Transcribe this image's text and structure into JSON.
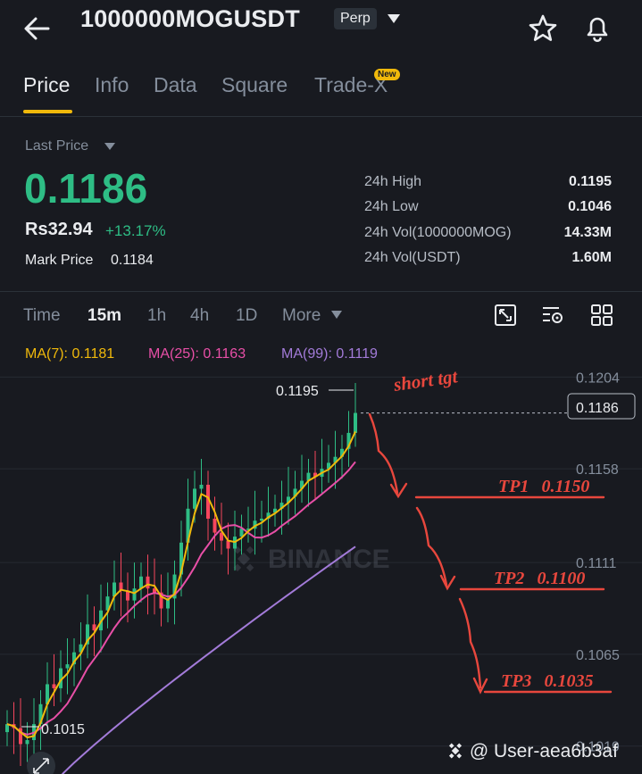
{
  "header": {
    "pair": "1000000MOGUSDT",
    "contract_type": "Perp",
    "icons": [
      "back-arrow-icon",
      "chevron-down-icon",
      "star-icon",
      "bell-icon"
    ]
  },
  "tabs": [
    {
      "label": "Price",
      "active": true
    },
    {
      "label": "Info"
    },
    {
      "label": "Data"
    },
    {
      "label": "Square"
    },
    {
      "label": "Trade-X",
      "badge": "New"
    }
  ],
  "ticker": {
    "last_price_label": "Last Price",
    "last_price": "0.1186",
    "fiat_price": "Rs32.94",
    "change_pct": "+13.17%",
    "mark_price_label": "Mark Price",
    "mark_price": "0.1184",
    "stats": [
      {
        "label": "24h High",
        "value": "0.1195"
      },
      {
        "label": "24h Low",
        "value": "0.1046"
      },
      {
        "label": "24h Vol(1000000MOG)",
        "value": "14.33M"
      },
      {
        "label": "24h Vol(USDT)",
        "value": "1.60M"
      }
    ]
  },
  "timeframes": [
    {
      "label": "Time"
    },
    {
      "label": "15m",
      "active": true
    },
    {
      "label": "1h"
    },
    {
      "label": "4h"
    },
    {
      "label": "1D"
    },
    {
      "label": "More"
    }
  ],
  "chart_tools": [
    "expand-chart-icon",
    "indicator-settings-icon",
    "layout-grid-icon"
  ],
  "indicators": {
    "ma7": {
      "label": "MA(7): 0.1181",
      "color": "#f0b90b"
    },
    "ma25": {
      "label": "MA(25): 0.1163",
      "color": "#e84fa7"
    },
    "ma99": {
      "label": "MA(99): 0.1119",
      "color": "#a37bd9"
    }
  },
  "chart_data": {
    "type": "candlestick",
    "y_ticks": [
      "0.1204",
      "0.1158",
      "0.1111",
      "0.1065",
      "0.1019"
    ],
    "current_price_tag": "0.1186",
    "high_label": "0.1195",
    "low_label": "0.1015",
    "watermark_logo": "BINANCE",
    "annotations": {
      "short_target": "short tgt",
      "targets": [
        {
          "label": "TP1",
          "value": "0.1150"
        },
        {
          "label": "TP2",
          "value": "0.1100"
        },
        {
          "label": "TP3",
          "value": "0.1035"
        }
      ]
    },
    "closes": [
      0.103,
      0.1028,
      0.102,
      0.1022,
      0.103,
      0.104,
      0.105,
      0.1048,
      0.1058,
      0.106,
      0.1066,
      0.107,
      0.108,
      0.1077,
      0.1087,
      0.1094,
      0.1101,
      0.1097,
      0.1092,
      0.1098,
      0.1104,
      0.1098,
      0.1096,
      0.1088,
      0.1093,
      0.1105,
      0.1121,
      0.1138,
      0.1148,
      0.115,
      0.1133,
      0.1126,
      0.1122,
      0.1118,
      0.1124,
      0.1128,
      0.1128,
      0.1132,
      0.1133,
      0.1136,
      0.1138,
      0.1141,
      0.1144,
      0.1148,
      0.1152,
      0.1156,
      0.1154,
      0.1158,
      0.1161,
      0.1164,
      0.1168,
      0.1176,
      0.1186
    ],
    "ylim": [
      0.1005,
      0.1214
    ]
  },
  "footer": {
    "watermark": "@ User-aea6b3af"
  },
  "colors": {
    "up": "#2ebd85",
    "down": "#f6465d",
    "accent": "#f0b90b",
    "annotation": "#e8473d"
  }
}
